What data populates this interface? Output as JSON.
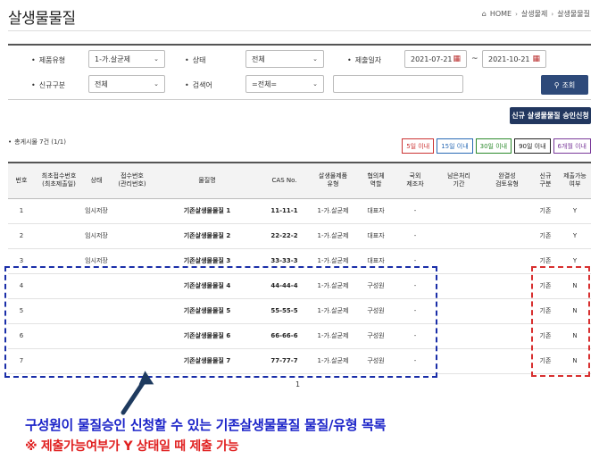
{
  "page": {
    "title": "살생물물질"
  },
  "breadcrumb": {
    "home": "HOME",
    "level1": "살생물제",
    "level2": "살생물물질"
  },
  "search": {
    "product_type_label": "제품유형",
    "product_type_value": "1-가.살균제",
    "status_label": "상태",
    "status_value": "전체",
    "submit_date_label": "제출일자",
    "date_from": "2021-07-21",
    "date_tilde": "~",
    "date_to": "2021-10-21",
    "new_type_label": "신규구분",
    "new_type_value": "전체",
    "keyword_label": "검색어",
    "keyword_type_value": "=전체=",
    "keyword_value": "",
    "search_button": "조회"
  },
  "actions": {
    "apply_button": "신규 살생물물질 승인신청"
  },
  "summary": {
    "total_text": "총게시물 7건 (1/1)"
  },
  "quick_filters": [
    {
      "label": "5일 이내",
      "color": "#cc3333"
    },
    {
      "label": "15일 이내",
      "color": "#2a6ab5"
    },
    {
      "label": "30일 이내",
      "color": "#2c8a2c"
    },
    {
      "label": "90일 이내",
      "color": "#222222"
    },
    {
      "label": "6개월 이내",
      "color": "#7a3a9a"
    }
  ],
  "table": {
    "headers": [
      "번호",
      "최초접수번호\n(최초제출일)",
      "상태",
      "접수번호\n(관리번호)",
      "물질명",
      "CAS No.",
      "살생물제품\n유형",
      "협의체\n역할",
      "국외\n제조자",
      "남은처리\n기간",
      "완결성\n검토유형",
      "신규\n구분",
      "제출가능\n여부"
    ],
    "rows": [
      {
        "no": "1",
        "first_receipt": "",
        "status": "임시저장",
        "receipt": "",
        "material": "기존살생물물질 1",
        "cas": "11-11-1",
        "product_type": "1-가.살균제",
        "role": "대표자",
        "foreign_maker": "-",
        "remaining": "",
        "completeness": "",
        "new_type": "기존",
        "submittable": "Y"
      },
      {
        "no": "2",
        "first_receipt": "",
        "status": "임시저장",
        "receipt": "",
        "material": "기존살생물물질 2",
        "cas": "22-22-2",
        "product_type": "1-가.살균제",
        "role": "대표자",
        "foreign_maker": "-",
        "remaining": "",
        "completeness": "",
        "new_type": "기존",
        "submittable": "Y"
      },
      {
        "no": "3",
        "first_receipt": "",
        "status": "임시저장",
        "receipt": "",
        "material": "기존살생물물질 3",
        "cas": "33-33-3",
        "product_type": "1-가.살균제",
        "role": "대표자",
        "foreign_maker": "-",
        "remaining": "",
        "completeness": "",
        "new_type": "기존",
        "submittable": "Y"
      },
      {
        "no": "4",
        "first_receipt": "",
        "status": "",
        "receipt": "",
        "material": "기존살생물물질 4",
        "cas": "44-44-4",
        "product_type": "1-가.살균제",
        "role": "구성원",
        "foreign_maker": "-",
        "remaining": "",
        "completeness": "",
        "new_type": "기존",
        "submittable": "N"
      },
      {
        "no": "5",
        "first_receipt": "",
        "status": "",
        "receipt": "",
        "material": "기존살생물물질 5",
        "cas": "55-55-5",
        "product_type": "1-가.살균제",
        "role": "구성원",
        "foreign_maker": "-",
        "remaining": "",
        "completeness": "",
        "new_type": "기존",
        "submittable": "N"
      },
      {
        "no": "6",
        "first_receipt": "",
        "status": "",
        "receipt": "",
        "material": "기존살생물물질 6",
        "cas": "66-66-6",
        "product_type": "1-가.살균제",
        "role": "구성원",
        "foreign_maker": "-",
        "remaining": "",
        "completeness": "",
        "new_type": "기존",
        "submittable": "N"
      },
      {
        "no": "7",
        "first_receipt": "",
        "status": "",
        "receipt": "",
        "material": "기존살생물물질 7",
        "cas": "77-77-7",
        "product_type": "1-가.살균제",
        "role": "구성원",
        "foreign_maker": "-",
        "remaining": "",
        "completeness": "",
        "new_type": "기존",
        "submittable": "N"
      }
    ]
  },
  "pagination": {
    "current": "1"
  },
  "annotation": {
    "caption_main": "구성원이 물질승인 신청할 수 있는 기존살생물물질 물질/유형 목록",
    "caption_note": "※ 제출가능여부가 Y 상태일 때 제출 가능",
    "blue_color": "#1a22c8",
    "red_color": "#e02020"
  }
}
